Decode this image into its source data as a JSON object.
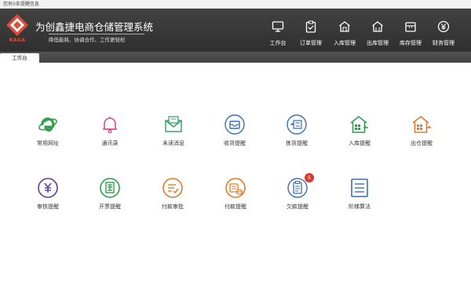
{
  "window": {
    "title": "您有0条提醒信息"
  },
  "header": {
    "logo_text": "RAGA",
    "title": "为创鑫捷电商仓储管理系统",
    "slogan": "降低能耗、协调合作、工作更轻松",
    "nav": [
      {
        "label": "工作台",
        "icon": "monitor-icon"
      },
      {
        "label": "订单管理",
        "icon": "clipboard-check-icon"
      },
      {
        "label": "入库管理",
        "icon": "warehouse-in-icon"
      },
      {
        "label": "出库管理",
        "icon": "warehouse-out-icon"
      },
      {
        "label": "库存管理",
        "icon": "box-icon"
      },
      {
        "label": "财务管理",
        "icon": "yen-circle-icon"
      }
    ]
  },
  "tabs": [
    {
      "label": "工作台"
    }
  ],
  "tiles": [
    {
      "label": "常用网址",
      "icon": "ie-browser-icon",
      "color": "#2e9e4a"
    },
    {
      "label": "通讯录",
      "icon": "bell-icon",
      "color": "#d84f8c"
    },
    {
      "label": "未读消息",
      "icon": "envelope-icon",
      "color": "#3aa36a"
    },
    {
      "label": "收货提醒",
      "icon": "inbox-icon",
      "color": "#3b6fb0"
    },
    {
      "label": "拣货提醒",
      "icon": "pick-icon",
      "color": "#3b6fb0"
    },
    {
      "label": "入库提醒",
      "icon": "warehouse-in-icon",
      "color": "#2e9e4a"
    },
    {
      "label": "出仓提醒",
      "icon": "warehouse-out-icon",
      "color": "#e07b2e"
    },
    {
      "label": "审核提醒",
      "icon": "yen-circle-icon",
      "color": "#5a3f97"
    },
    {
      "label": "开票提醒",
      "icon": "invoice-icon",
      "color": "#2e9e4a"
    },
    {
      "label": "付款审批",
      "icon": "approve-icon",
      "color": "#e07b2e"
    },
    {
      "label": "付款提醒",
      "icon": "coins-icon",
      "color": "#e07b2e"
    },
    {
      "label": "欠款提醒",
      "icon": "debt-icon",
      "color": "#3b6fb0",
      "badge": "5"
    },
    {
      "label": "阶梯算法",
      "icon": "list-icon",
      "color": "#3b6fb0"
    }
  ],
  "colors": {
    "header_bg": "#3a3a3a",
    "badge": "#d9392a",
    "logo": "#e04a3a"
  }
}
